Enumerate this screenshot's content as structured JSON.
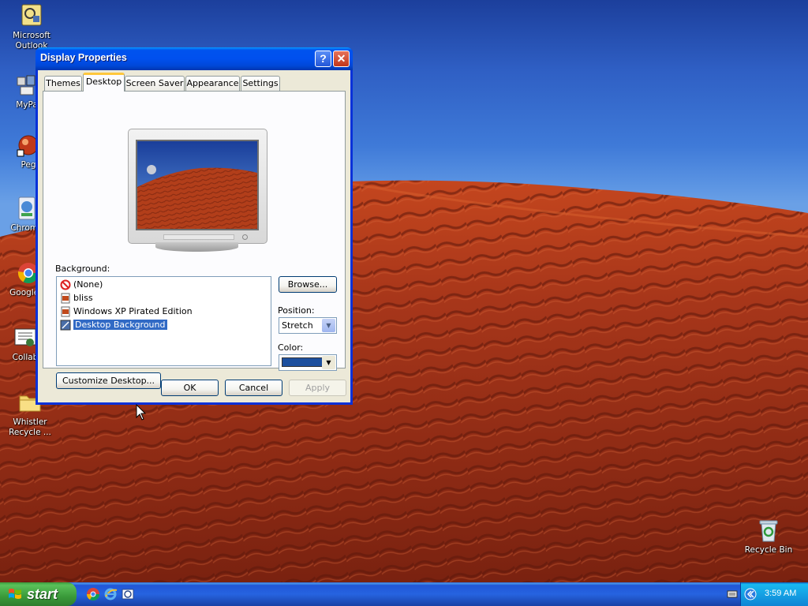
{
  "desktop": {
    "icons": [
      {
        "label": "Microsoft\nOutlook",
        "icon": "outlook-icon"
      },
      {
        "label": "MyPa",
        "icon": "mypc-icon"
      },
      {
        "label": "Peg",
        "icon": "pegasus-icon"
      },
      {
        "label": "Chrome",
        "icon": "chrome-setup-icon"
      },
      {
        "label": "Google C",
        "icon": "google-chrome-icon"
      },
      {
        "label": "Collab",
        "icon": "collab-icon"
      },
      {
        "label": "Whistler\nRecycle ...",
        "icon": "folder-icon"
      },
      {
        "label": "Recycle Bin",
        "icon": "recycle-bin-icon"
      }
    ]
  },
  "window": {
    "title": "Display Properties",
    "help_glyph": "?",
    "close_glyph": "✕",
    "tabs": [
      {
        "label": "Themes",
        "active": false
      },
      {
        "label": "Desktop",
        "active": true
      },
      {
        "label": "Screen Saver",
        "active": false
      },
      {
        "label": "Appearance",
        "active": false
      },
      {
        "label": "Settings",
        "active": false
      }
    ],
    "background_label": "Background:",
    "background_items": [
      {
        "label": "(None)",
        "icon": "none-icon",
        "selected": false
      },
      {
        "label": "bliss",
        "icon": "image-file-icon",
        "selected": false
      },
      {
        "label": "Windows XP Pirated Edition",
        "icon": "image-file-icon",
        "selected": false
      },
      {
        "label": "Desktop Background",
        "icon": "image-file-icon",
        "selected": true
      }
    ],
    "browse_label": "Browse...",
    "position_label": "Position:",
    "position_value": "Stretch",
    "color_label": "Color:",
    "color_value": "#1c4f9e",
    "customize_label": "Customize Desktop...",
    "ok_label": "OK",
    "cancel_label": "Cancel",
    "apply_label": "Apply"
  },
  "taskbar": {
    "start_label": "start",
    "quick_launch": [
      "chrome-icon",
      "ie-icon",
      "outlook-express-icon"
    ],
    "clock": "3:59 AM",
    "tray_icons": [
      "expand-tray-icon",
      "keyboard-icon"
    ]
  }
}
